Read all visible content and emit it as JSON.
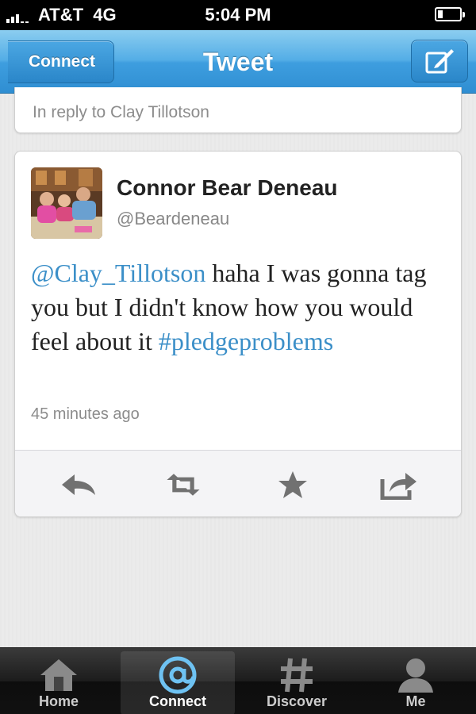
{
  "status_bar": {
    "carrier": "AT&T",
    "network": "4G",
    "time": "5:04 PM",
    "battery_level": 0.2
  },
  "nav_bar": {
    "back_label": "Connect",
    "title": "Tweet",
    "compose_icon": "compose-icon"
  },
  "reply_context": {
    "text": "In reply to Clay Tillotson"
  },
  "tweet": {
    "author_name": "Connor Bear Deneau",
    "author_handle": "@Beardeneau",
    "mention": "@Clay_Tillotson",
    "text": "haha I was gonna tag you but I didn't know how you would feel about it",
    "hashtag": "#pledgeproblems",
    "timestamp": "45 minutes ago",
    "link_color": "#3b8fc8"
  },
  "actions": [
    "reply-icon",
    "retweet-icon",
    "favorite-icon",
    "share-icon"
  ],
  "tab_bar": {
    "tabs": [
      {
        "label": "Home",
        "icon": "home-icon",
        "active": false
      },
      {
        "label": "Connect",
        "icon": "at-icon",
        "active": true
      },
      {
        "label": "Discover",
        "icon": "hash-icon",
        "active": false
      },
      {
        "label": "Me",
        "icon": "person-icon",
        "active": false
      }
    ]
  }
}
